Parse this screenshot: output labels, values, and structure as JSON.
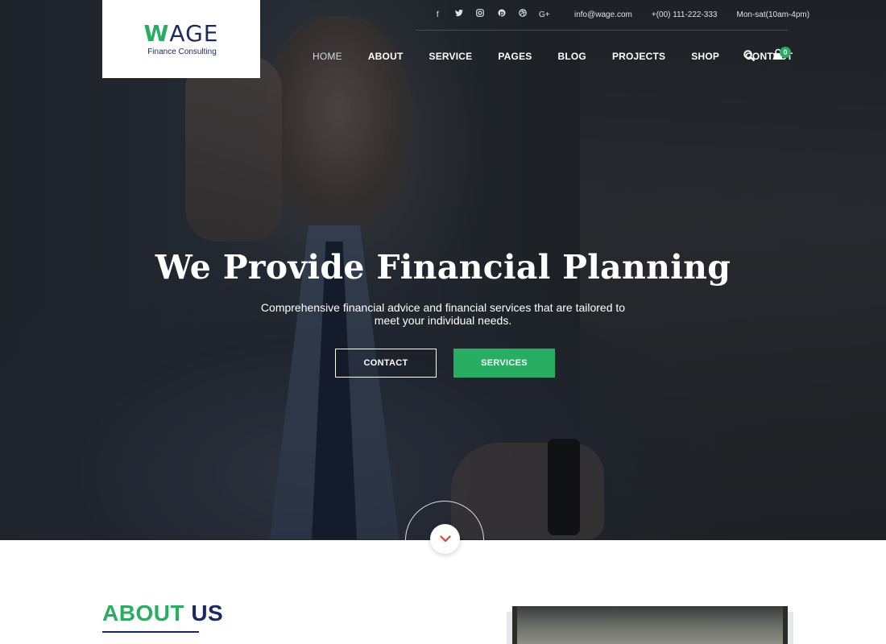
{
  "brand": {
    "logo_main": "AGE",
    "logo_w": "W",
    "tagline": "Finance Consulting"
  },
  "topbar": {
    "social": [
      "facebook-icon",
      "twitter-icon",
      "instagram-icon",
      "pinterest-icon",
      "dribbble-icon",
      "google-plus-icon"
    ],
    "email": "info@wage.com",
    "phone": "+(00) 111-222-333",
    "hours": "Mon-sat(10am-4pm)"
  },
  "nav": {
    "items": [
      "HOME",
      "ABOUT",
      "SERVICE",
      "PAGES",
      "BLOG",
      "PROJECTS",
      "SHOP",
      "CONTACT"
    ],
    "active": "HOME",
    "cart_count": "0"
  },
  "hero": {
    "title": "We Provide Financial Planning",
    "subtitle": "Comprehensive financial advice and financial services that are tailored to meet your individual needs.",
    "btn_contact": "CONTACT",
    "btn_services": "SERVICES"
  },
  "about": {
    "title_light": "ABOUT",
    "title_strong": "US"
  },
  "colors": {
    "accent": "#27ae60",
    "navy": "#1b2a5e"
  }
}
